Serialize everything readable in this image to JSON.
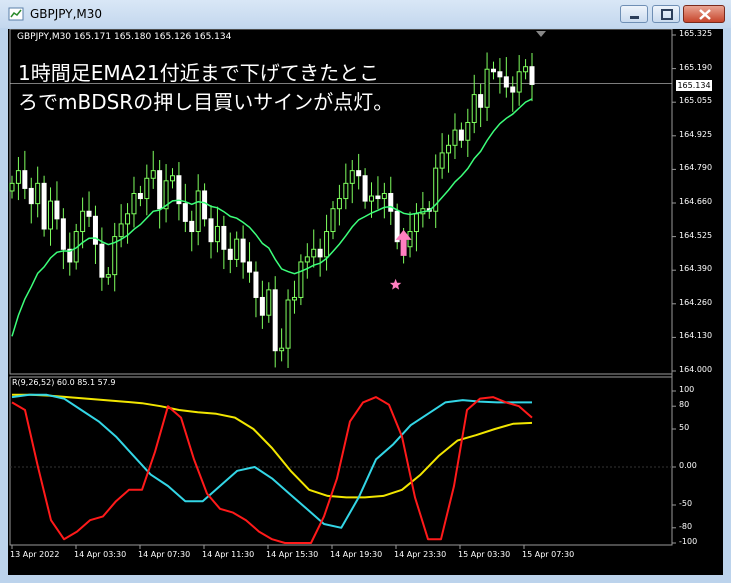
{
  "window": {
    "title": "GBPJPY,M30"
  },
  "chart": {
    "ohlc_label": "GBPJPY,M30  165.171 165.180 165.126 165.134",
    "annotation_lines": [
      "1時間足EMA21付近まで下げてきたとこ",
      "ろでmBDSRの押し目買いサインが点灯。"
    ],
    "current_price": "165.134",
    "price_axis": [
      "165.325",
      "165.190",
      "165.055",
      "164.925",
      "164.790",
      "164.660",
      "164.525",
      "164.390",
      "164.260",
      "164.130",
      "164.000"
    ],
    "indicator_label": "R(9,26,52) 60.0 85.1 57.9",
    "oscillator_axis": [
      "100",
      "80",
      "50",
      "0.00",
      "-50",
      "-80",
      "-100"
    ],
    "time_axis": [
      "13 Apr 2022",
      "14 Apr 03:30",
      "14 Apr 07:30",
      "14 Apr 11:30",
      "14 Apr 15:30",
      "14 Apr 19:30",
      "14 Apr 23:30",
      "15 Apr 03:30",
      "15 Apr 07:30"
    ],
    "colors": {
      "candles": "#7fff5f",
      "ema": "#3cff7a",
      "osc_red": "#ff1a1a",
      "osc_cyan": "#33d6e6",
      "osc_yellow": "#f2e600",
      "signal": "#ff7fc0"
    }
  },
  "chart_data": {
    "type": "line",
    "title": "GBPJPY,M30",
    "ylim": [
      164.0,
      165.325
    ],
    "series": [
      {
        "name": "",
        "values": [
          164.74,
          164.79,
          164.72,
          164.66,
          164.74,
          164.56,
          164.67,
          164.6,
          164.48,
          164.43,
          164.55,
          164.63,
          164.61,
          164.5,
          164.37,
          164.38,
          164.53,
          164.58,
          164.62,
          164.7,
          164.68,
          164.76,
          164.79,
          164.64,
          164.75,
          164.77,
          164.66,
          164.59,
          164.55,
          164.71,
          164.6,
          164.51,
          164.57,
          164.48,
          164.44,
          164.52,
          164.43,
          164.39,
          164.29,
          164.22,
          164.32,
          164.08,
          164.09,
          164.28,
          164.29,
          164.43,
          164.45,
          164.48,
          164.45,
          164.55,
          164.64,
          164.68,
          164.74,
          164.79,
          164.77,
          164.67,
          164.69,
          164.68,
          164.7,
          164.63,
          164.51,
          164.49,
          164.55,
          164.62,
          164.64,
          164.63,
          164.8,
          164.86,
          164.89,
          164.95,
          164.91,
          164.98,
          165.09,
          165.04,
          165.19,
          165.18,
          165.16,
          165.12,
          165.1,
          165.18,
          165.2,
          165.13
        ]
      }
    ]
  },
  "indicator_data": {
    "ylim": [
      -100,
      100
    ],
    "red": [
      85,
      75,
      0,
      -70,
      -95,
      -85,
      -70,
      -65,
      -45,
      -30,
      -30,
      20,
      80,
      65,
      10,
      -35,
      -55,
      -60,
      -70,
      -85,
      -95,
      -100,
      -100,
      -100,
      -65,
      -15,
      60,
      85,
      92,
      82,
      40,
      -40,
      -95,
      -95,
      -25,
      75,
      90,
      92,
      85,
      80,
      65
    ],
    "cyan": [
      92,
      95,
      95,
      90,
      75,
      60,
      40,
      15,
      -10,
      -25,
      -45,
      -45,
      -25,
      -5,
      0,
      -15,
      -35,
      -55,
      -75,
      -80,
      -40,
      10,
      30,
      55,
      70,
      85,
      88,
      86,
      85,
      85,
      85
    ],
    "yellow": [
      95,
      95,
      94,
      92,
      90,
      88,
      86,
      84,
      80,
      75,
      72,
      70,
      65,
      50,
      25,
      -5,
      -30,
      -38,
      -40,
      -40,
      -38,
      -30,
      -10,
      15,
      35,
      42,
      50,
      57,
      58
    ]
  }
}
